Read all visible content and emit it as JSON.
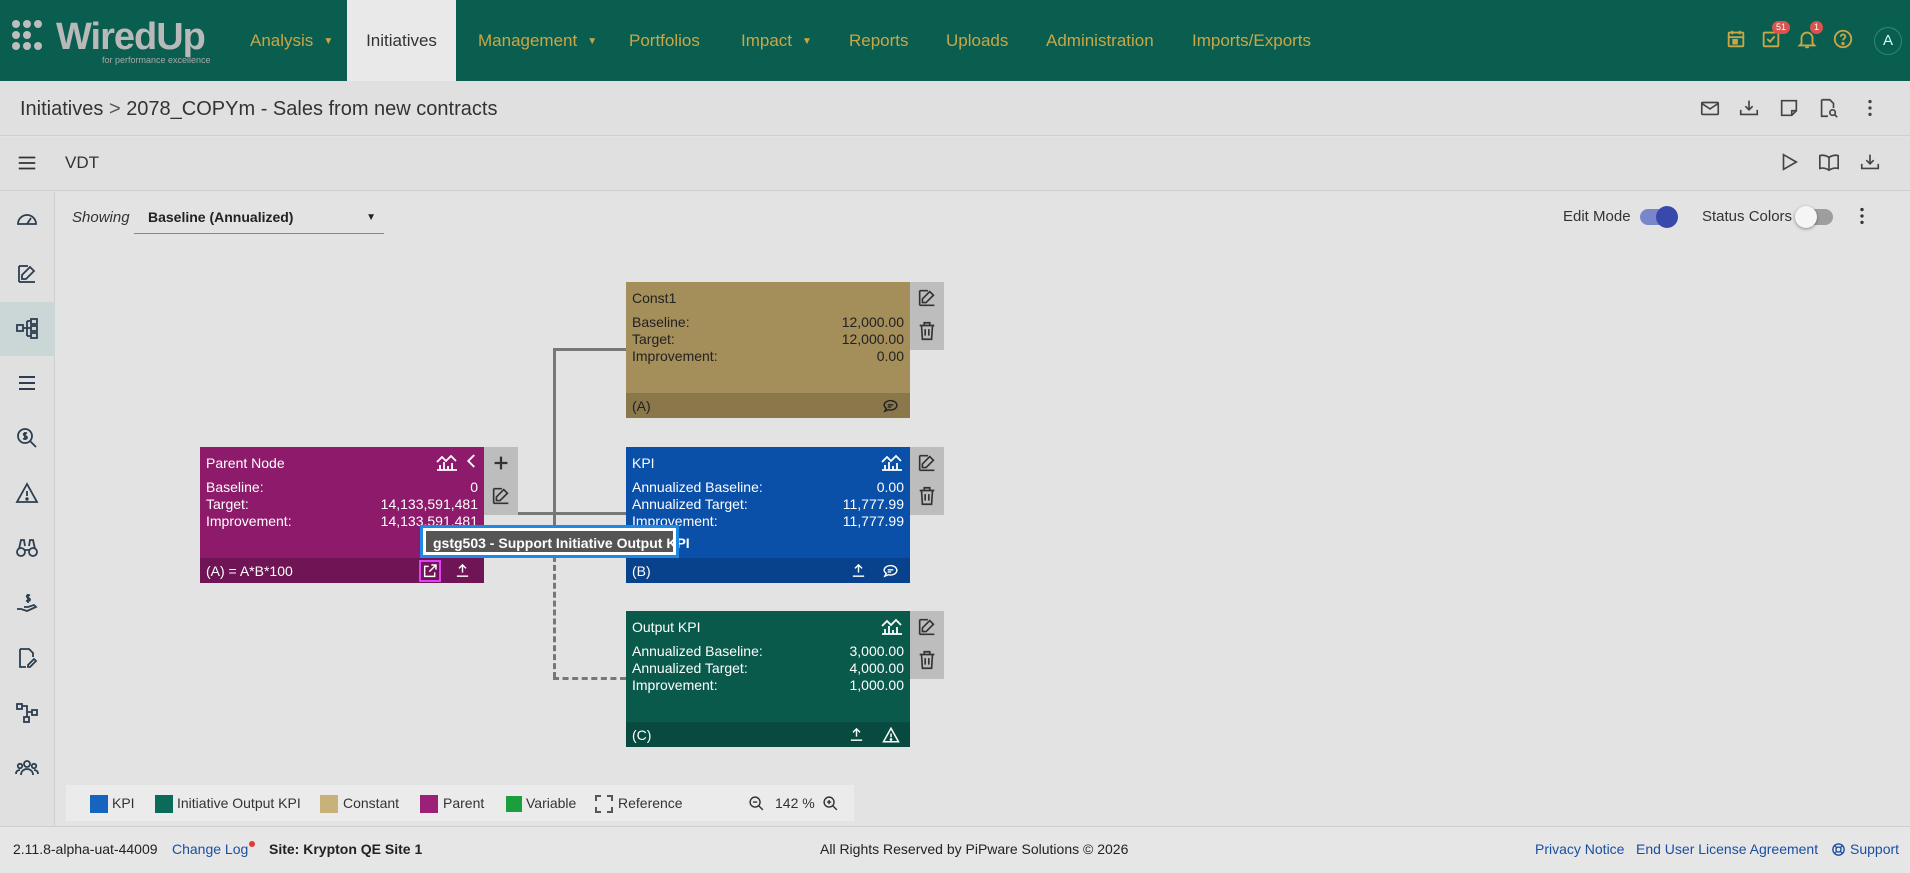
{
  "brand": {
    "name": "WiredUp",
    "tagline": "for performance excellence"
  },
  "nav": {
    "items": [
      {
        "label": "Analysis",
        "caret": "▼"
      },
      {
        "label": "Initiatives"
      },
      {
        "label": "Management",
        "caret": "▼"
      },
      {
        "label": "Portfolios"
      },
      {
        "label": "Impact",
        "caret": "▼"
      },
      {
        "label": "Reports"
      },
      {
        "label": "Uploads"
      },
      {
        "label": "Administration"
      },
      {
        "label": "Imports/Exports"
      }
    ],
    "badges": {
      "tasks": "51",
      "notifications": "1"
    },
    "avatar": "A"
  },
  "breadcrumb": {
    "root": "Initiatives",
    "separator": ">",
    "current": "2078_COPYm - Sales from new contracts"
  },
  "module": {
    "title": "VDT"
  },
  "controls": {
    "showing_label": "Showing",
    "showing_value": "Baseline (Annualized)",
    "edit_mode_label": "Edit Mode",
    "edit_mode_on": true,
    "status_colors_label": "Status Colors",
    "status_colors_on": false
  },
  "nodes": {
    "const1": {
      "title": "Const1",
      "rows": [
        {
          "label": "Baseline:",
          "value": "12,000.00"
        },
        {
          "label": "Target:",
          "value": "12,000.00"
        },
        {
          "label": "Improvement:",
          "value": "0.00"
        }
      ],
      "footer": "(A)",
      "color": "#a48e5a"
    },
    "parent": {
      "title": "Parent Node",
      "rows": [
        {
          "label": "Baseline:",
          "value": "0"
        },
        {
          "label": "Target:",
          "value": "14,133,591,481"
        },
        {
          "label": "Improvement:",
          "value": "14,133,591,481"
        }
      ],
      "footer": "(A) = A*B*100",
      "color": "#8e1a6b"
    },
    "kpi": {
      "title": "KPI",
      "rows": [
        {
          "label": "Annualized Baseline:",
          "value": "0.00"
        },
        {
          "label": "Annualized Target:",
          "value": "11,777.99"
        },
        {
          "label": "Improvement:",
          "value": "11,777.99"
        }
      ],
      "footer": "(B)",
      "color": "#0a4fa8"
    },
    "output": {
      "title": "Output KPI",
      "rows": [
        {
          "label": "Annualized Baseline:",
          "value": "3,000.00"
        },
        {
          "label": "Annualized Target:",
          "value": "4,000.00"
        },
        {
          "label": "Improvement:",
          "value": "1,000.00"
        }
      ],
      "footer": "(C)",
      "color": "#0a5a4c"
    }
  },
  "tooltip": {
    "text": "gstg503 - Support Initiative Output KPI"
  },
  "legend": {
    "items": [
      {
        "label": "KPI",
        "color": "#1565c0"
      },
      {
        "label": "Initiative Output KPI",
        "color": "#0a6b5a"
      },
      {
        "label": "Constant",
        "color": "#c9b27a"
      },
      {
        "label": "Parent",
        "color": "#9c1f78"
      },
      {
        "label": "Variable",
        "color": "#1b9e3e"
      },
      {
        "label": "Reference",
        "color": ""
      }
    ],
    "zoom": "142 %"
  },
  "footer": {
    "version": "2.11.8-alpha-uat-44009",
    "changelog": "Change Log",
    "site": "Site: Krypton QE Site 1",
    "copyright": "All Rights Reserved by PiPware Solutions © 2026",
    "privacy": "Privacy Notice",
    "eula": "End User License Agreement",
    "support": "Support"
  }
}
